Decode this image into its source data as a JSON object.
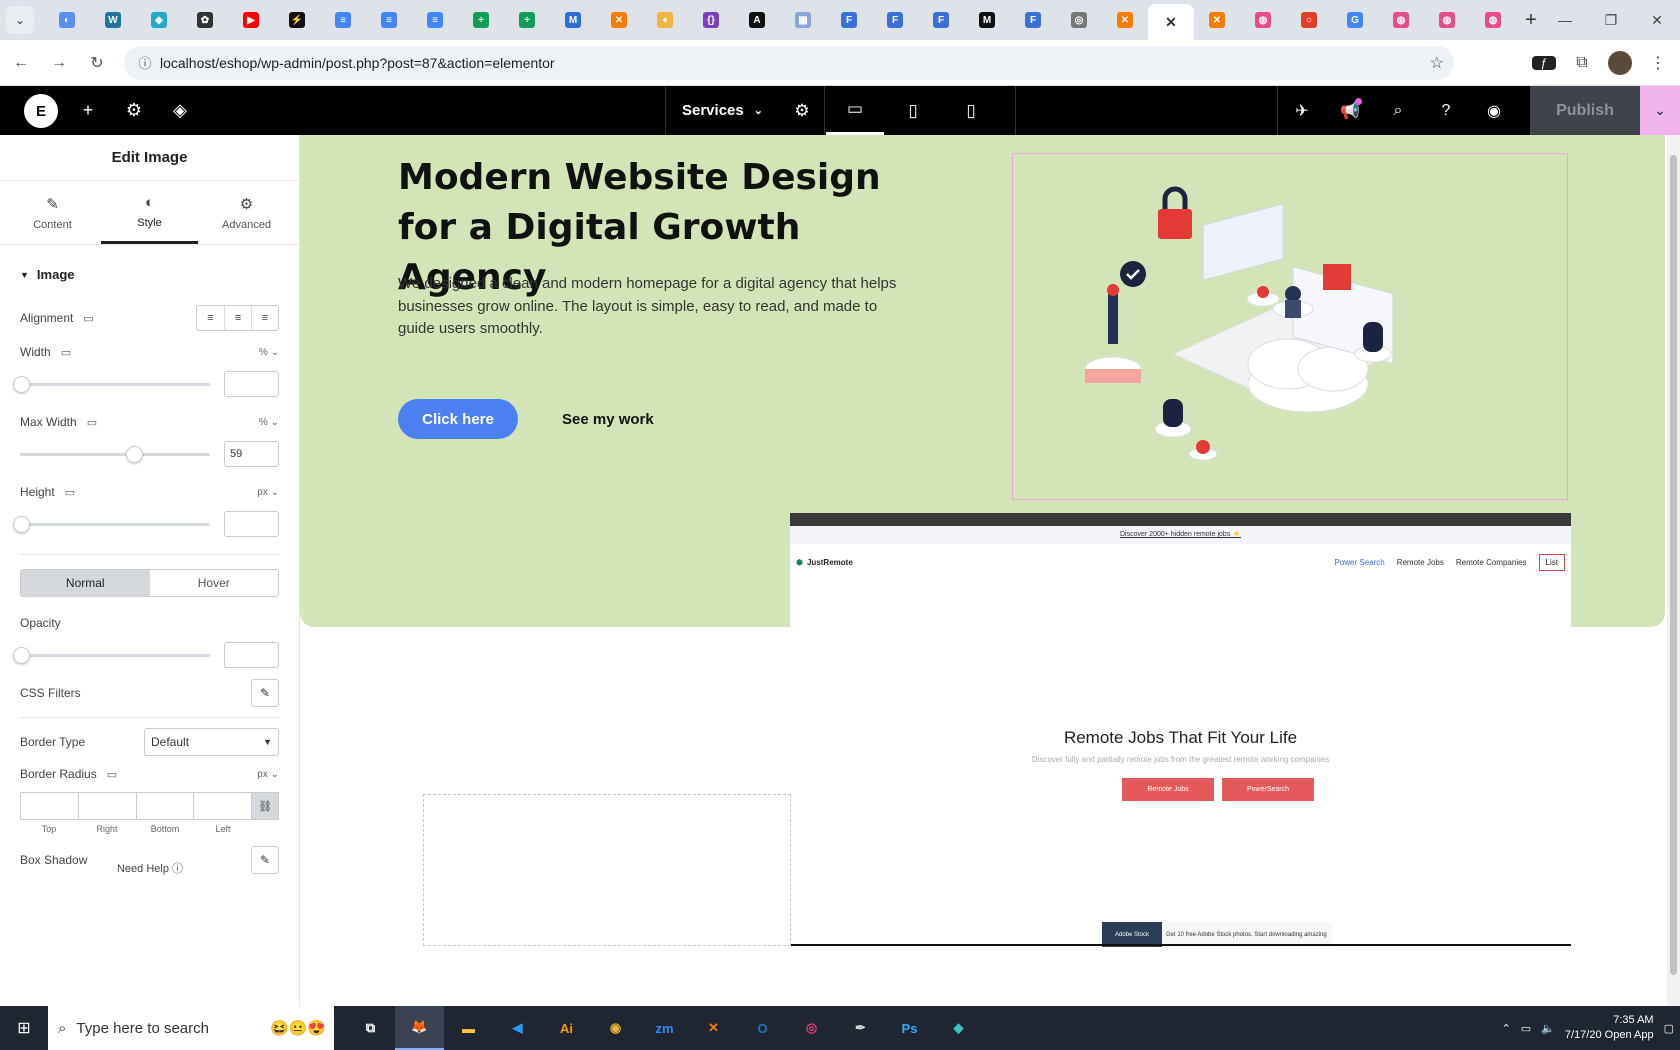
{
  "browser": {
    "url": "localhost/eshop/wp-admin/post.php?post=87&action=elementor",
    "tabs": [
      {
        "icon": "app-icon",
        "color": "#5b8def",
        "glyph": "◐"
      },
      {
        "icon": "wordpress-icon",
        "color": "#21759b",
        "glyph": "W"
      },
      {
        "icon": "app-icon",
        "color": "#24a9c6",
        "glyph": "◆"
      },
      {
        "icon": "openai-icon",
        "color": "#333333",
        "glyph": "✿"
      },
      {
        "icon": "youtube-icon",
        "color": "#ff0000",
        "glyph": "▶"
      },
      {
        "icon": "bolt-icon",
        "color": "#111111",
        "glyph": "⚡"
      },
      {
        "icon": "docs-icon",
        "color": "#4285f4",
        "glyph": "≡"
      },
      {
        "icon": "docs-icon",
        "color": "#4285f4",
        "glyph": "≡"
      },
      {
        "icon": "docs-icon",
        "color": "#4285f4",
        "glyph": "≡"
      },
      {
        "icon": "sheets-icon",
        "color": "#0f9d58",
        "glyph": "+"
      },
      {
        "icon": "sheets-icon",
        "color": "#0f9d58",
        "glyph": "+"
      },
      {
        "icon": "app-icon",
        "color": "#2a6fd6",
        "glyph": "M"
      },
      {
        "icon": "xampp-icon",
        "color": "#f57c00",
        "glyph": "✕"
      },
      {
        "icon": "app-icon",
        "color": "#f2b43a",
        "glyph": "♦"
      },
      {
        "icon": "code-icon",
        "color": "#7a3fc0",
        "glyph": "{}"
      },
      {
        "icon": "app-icon",
        "color": "#111111",
        "glyph": "A"
      },
      {
        "icon": "app-icon",
        "color": "#8aa6d8",
        "glyph": "▦"
      },
      {
        "icon": "forms-icon",
        "color": "#3b6fd8",
        "glyph": "F"
      },
      {
        "icon": "forms-icon",
        "color": "#3b6fd8",
        "glyph": "F"
      },
      {
        "icon": "forms-icon",
        "color": "#3b6fd8",
        "glyph": "F"
      },
      {
        "icon": "medium-icon",
        "color": "#111111",
        "glyph": "M"
      },
      {
        "icon": "forms-icon",
        "color": "#3b6fd8",
        "glyph": "F"
      },
      {
        "icon": "globe-icon",
        "color": "#777777",
        "glyph": "◎"
      },
      {
        "icon": "xampp-icon",
        "color": "#f57c00",
        "glyph": "✕"
      },
      {
        "icon": "close-icon",
        "color": "#ffffff",
        "glyph": "✕",
        "active": true
      },
      {
        "icon": "xampp-icon",
        "color": "#f57c00",
        "glyph": "✕"
      },
      {
        "icon": "dribbble-icon",
        "color": "#ea4c89",
        "glyph": "◍"
      },
      {
        "icon": "app-icon",
        "color": "#e0402a",
        "glyph": "○"
      },
      {
        "icon": "google-icon",
        "color": "#4285f4",
        "glyph": "G"
      },
      {
        "icon": "dribbble-icon",
        "color": "#ea4c89",
        "glyph": "◍"
      },
      {
        "icon": "dribbble-icon",
        "color": "#ea4c89",
        "glyph": "◍"
      },
      {
        "icon": "dribbble-icon",
        "color": "#ea4c89",
        "glyph": "◍"
      }
    ]
  },
  "editor": {
    "page_name": "Services",
    "publish_label": "Publish"
  },
  "panel": {
    "title": "Edit Image",
    "tabs": [
      {
        "label": "Content",
        "icon": "pencil-icon"
      },
      {
        "label": "Style",
        "icon": "contrast-icon"
      },
      {
        "label": "Advanced",
        "icon": "gear-icon"
      }
    ],
    "section": "Image",
    "alignment_label": "Alignment",
    "width_label": "Width",
    "width_unit": "%",
    "width_value": "",
    "max_width_label": "Max Width",
    "max_width_unit": "%",
    "max_width_value": "59",
    "height_label": "Height",
    "height_unit": "px",
    "height_value": "",
    "state_normal": "Normal",
    "state_hover": "Hover",
    "opacity_label": "Opacity",
    "opacity_value": "",
    "css_filters_label": "CSS Filters",
    "border_type_label": "Border Type",
    "border_type_value": "Default",
    "border_radius_label": "Border Radius",
    "border_radius_unit": "px",
    "dim_top": "Top",
    "dim_right": "Right",
    "dim_bottom": "Bottom",
    "dim_left": "Left",
    "box_shadow_label": "Box Shadow",
    "need_help": "Need Help",
    "slider_levels": {
      "width": 0,
      "max_width": 0.59,
      "height": 0,
      "opacity": 0
    }
  },
  "canvas": {
    "heading": "Modern Website Design for a Digital Growth Agency",
    "paragraph": "We designed a clean and modern homepage for a digital agency that helps businesses grow online. The layout is simple, easy to read, and made to guide users smoothly.",
    "cta_primary": "Click here",
    "cta_secondary": "See my work",
    "hero_bg": "#d3e5b8",
    "accent": "#4a80ef",
    "embedded": {
      "promo": "Discover 2000+ hidden remote jobs ⚡",
      "logo": "JustRemote",
      "nav": [
        "Power Search",
        "Remote Jobs",
        "Remote Companies"
      ],
      "nav_list": "List",
      "heading": "Remote Jobs That Fit Your Life",
      "sub": "Discover fully and partially remote jobs from the greatest remote working companies",
      "btn1": "Remote Jobs",
      "btn2": "PowerSearch",
      "ad_label": "Adobe Stock",
      "ad_text": "Get 10 free Adobe Stock photos. Start downloading amazing"
    }
  },
  "taskbar": {
    "search_placeholder": "Type here to search",
    "apps": [
      {
        "name": "task-view-icon",
        "glyph": "⧉"
      },
      {
        "name": "firefox-icon",
        "glyph": "🦊",
        "active": true
      },
      {
        "name": "file-explorer-icon",
        "glyph": "▬"
      },
      {
        "name": "vscode-icon",
        "glyph": "◀"
      },
      {
        "name": "illustrator-icon",
        "glyph": "Ai"
      },
      {
        "name": "chrome-icon",
        "glyph": "◉"
      },
      {
        "name": "zoom-icon",
        "glyph": "zm"
      },
      {
        "name": "xampp-icon",
        "glyph": "✕"
      },
      {
        "name": "outlook-icon",
        "glyph": "O"
      },
      {
        "name": "creative-cloud-icon",
        "glyph": "◎"
      },
      {
        "name": "pen-icon",
        "glyph": "✒"
      },
      {
        "name": "photoshop-icon",
        "glyph": "Ps"
      },
      {
        "name": "app-icon",
        "glyph": "◆"
      }
    ],
    "time": "7:35 AM",
    "date": "7/17/20",
    "open_app": "Open App"
  }
}
